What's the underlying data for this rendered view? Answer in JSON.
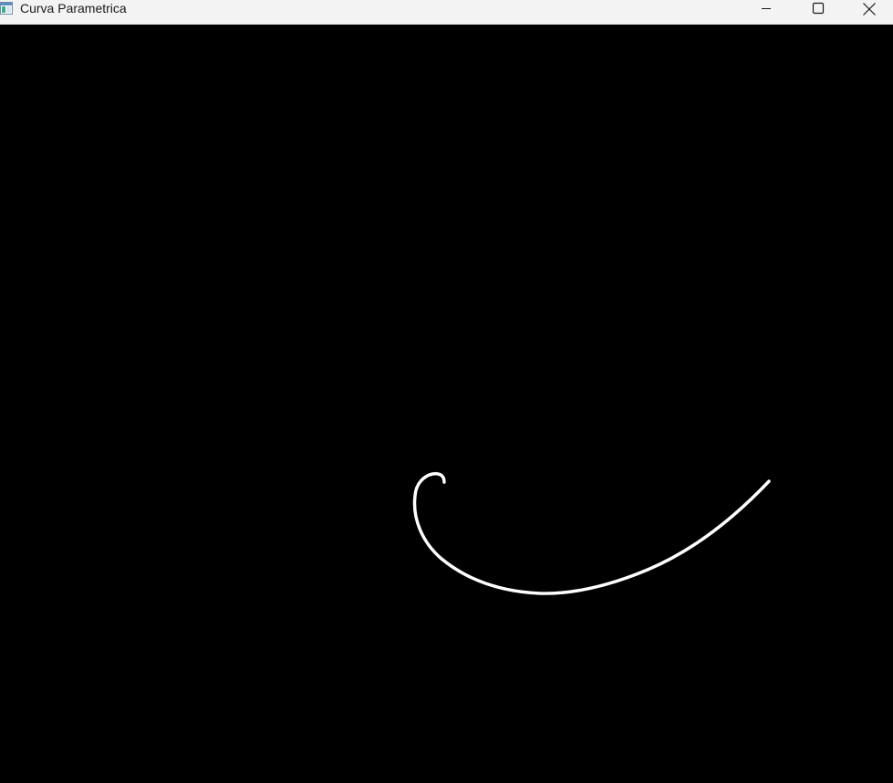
{
  "window": {
    "title": "Curva Parametrica",
    "app_icon": "window-app-icon",
    "controls": {
      "minimize_icon": "minimize-icon",
      "maximize_icon": "maximize-icon",
      "close_icon": "close-icon"
    }
  },
  "canvas": {
    "background_color": "#000000",
    "curve_color": "#ffffff",
    "curve_description": "white parametric spiral-like curve"
  }
}
